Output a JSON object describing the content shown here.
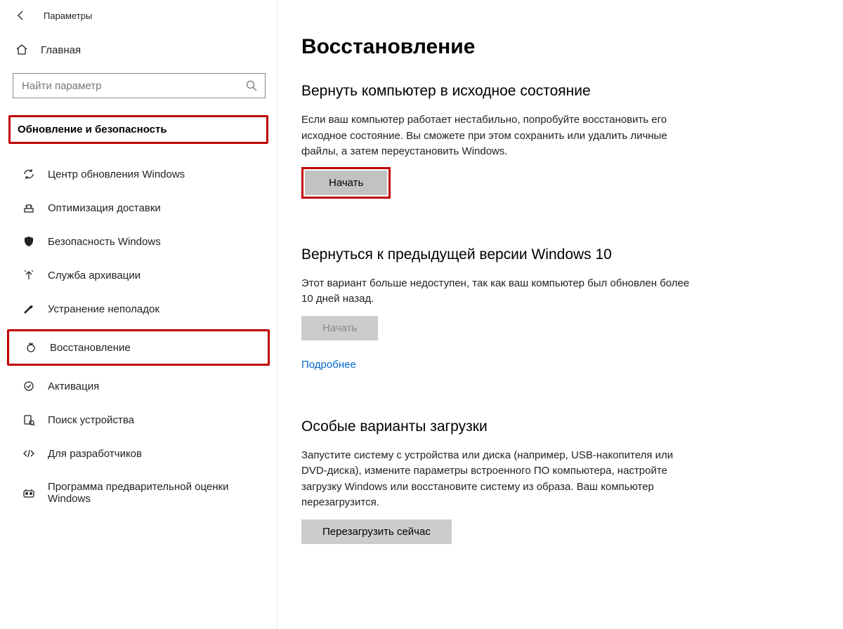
{
  "window": {
    "title": "Параметры"
  },
  "sidebar": {
    "home_label": "Главная",
    "search_placeholder": "Найти параметр",
    "section_label": "Обновление и безопасность",
    "items": [
      {
        "id": "windows-update",
        "label": "Центр обновления Windows"
      },
      {
        "id": "delivery-optimization",
        "label": "Оптимизация доставки"
      },
      {
        "id": "windows-security",
        "label": "Безопасность Windows"
      },
      {
        "id": "backup",
        "label": "Служба архивации"
      },
      {
        "id": "troubleshoot",
        "label": "Устранение неполадок"
      },
      {
        "id": "recovery",
        "label": "Восстановление"
      },
      {
        "id": "activation",
        "label": "Активация"
      },
      {
        "id": "find-device",
        "label": "Поиск устройства"
      },
      {
        "id": "for-developers",
        "label": "Для разработчиков"
      },
      {
        "id": "insider",
        "label": "Программа предварительной оценки Windows"
      }
    ]
  },
  "main": {
    "page_title": "Восстановление",
    "reset": {
      "heading": "Вернуть компьютер в исходное состояние",
      "text": "Если ваш компьютер работает нестабильно, попробуйте восстановить его исходное состояние. Вы сможете при этом сохранить или удалить личные файлы, а затем переустановить Windows.",
      "button": "Начать"
    },
    "goback": {
      "heading": "Вернуться к предыдущей версии Windows 10",
      "text": "Этот вариант больше недоступен, так как ваш компьютер был обновлен более 10 дней назад.",
      "button": "Начать",
      "link": "Подробнее"
    },
    "advanced": {
      "heading": "Особые варианты загрузки",
      "text": "Запустите систему с устройства или диска (например, USB-накопителя или DVD-диска), измените параметры встроенного ПО компьютера, настройте загрузку Windows или восстановите систему из образа. Ваш компьютер перезагрузится.",
      "button": "Перезагрузить сейчас"
    }
  }
}
